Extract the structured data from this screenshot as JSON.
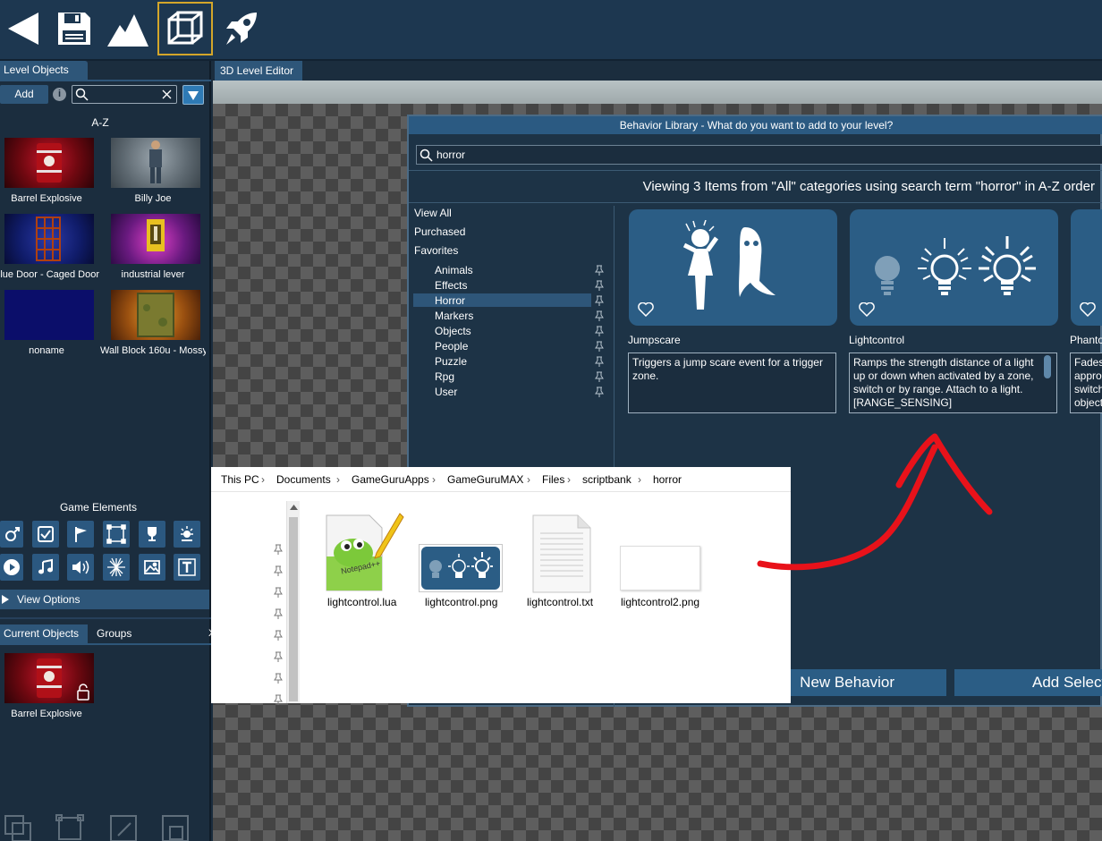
{
  "toolbar": {
    "icons": [
      "back-arrow-icon",
      "save-disk-icon",
      "terrain-mountain-icon",
      "cube-wireframe-icon",
      "rocket-icon"
    ],
    "active": "cube-wireframe-icon"
  },
  "left": {
    "tab_level_objects": "Level Objects",
    "add_label": "Add",
    "sort_label": "A-Z",
    "objects": [
      {
        "name": "Barrel Explosive"
      },
      {
        "name": "Billy Joe"
      },
      {
        "name": "Blue Door - Caged Door"
      },
      {
        "name": "industrial lever"
      },
      {
        "name": "noname"
      },
      {
        "name": "Wall Block 160u - Mossy"
      }
    ],
    "game_elements_label": "Game Elements",
    "view_options_label": "View Options",
    "tab_current_objects": "Current Objects",
    "tab_groups": "Groups",
    "current_objects": [
      {
        "name": "Barrel Explosive"
      }
    ]
  },
  "editor_tab": "3D Level Editor",
  "dialog": {
    "title": "Behavior Library - What do you want to add to your level?",
    "search_value": "horror",
    "viewing_text": "Viewing 3 Items from \"All\" categories using search term \"horror\" in A-Z order",
    "categories": [
      "View All",
      "Purchased",
      "Favorites"
    ],
    "subcategories": [
      "Animals",
      "Effects",
      "Horror",
      "Markers",
      "Objects",
      "People",
      "Puzzle",
      "Rpg",
      "User"
    ],
    "selected_sub": "Horror",
    "cards": [
      {
        "title": "Jumpscare",
        "desc": "Triggers a jump scare event for a trigger zone."
      },
      {
        "title": "Lightcontrol",
        "desc": "Ramps the strength distance of a light up or down when activated by a zone, switch or by range. Attach to a light. [RANGE_SENSING]"
      },
      {
        "title": "Phantom",
        "desc": "Fades approaching switch object"
      }
    ],
    "btn_new_behavior": "New Behavior",
    "btn_add_selected": "Add Selected"
  },
  "explorer": {
    "breadcrumb": [
      "This PC",
      "Documents",
      "GameGuruApps",
      "GameGuruMAX",
      "Files",
      "scriptbank",
      "horror"
    ],
    "files": [
      "lightcontrol.lua",
      "lightcontrol.png",
      "lightcontrol.txt",
      "lightcontrol2.png"
    ]
  },
  "colors": {
    "accent": "#2e5679",
    "highlight": "#d4a62a",
    "annotation": "#e8121a"
  }
}
